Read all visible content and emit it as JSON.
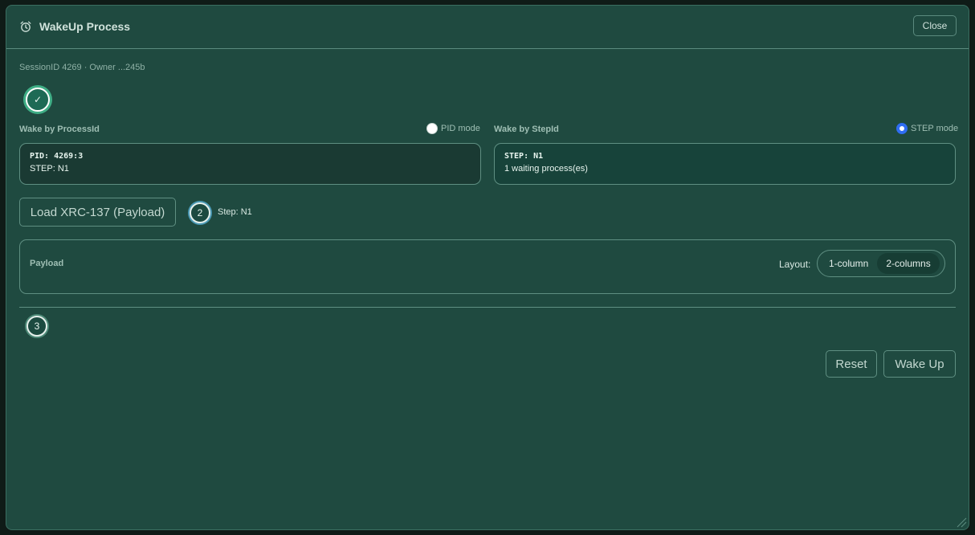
{
  "window": {
    "title": "WakeUp Process",
    "title_icon": "alarm-clock-icon",
    "close_label": "Close"
  },
  "session": {
    "text": "SessionID 4269 · Owner ...245b"
  },
  "steps": {
    "step1_mark": "✓",
    "step2_number": "2",
    "step2_label": "Step: N1",
    "step3_number": "3"
  },
  "pid_section": {
    "label": "Wake by ProcessId",
    "mode_label": "PID mode",
    "selected": false,
    "line1": "PID: 4269:3",
    "line2": "STEP: N1"
  },
  "step_section": {
    "label": "Wake by StepId",
    "mode_label": "STEP mode",
    "selected": true,
    "line1": "STEP: N1",
    "line2": "1 waiting process(es)"
  },
  "load_button": {
    "label": "Load XRC-137 (Payload)"
  },
  "payload": {
    "label": "Payload",
    "layout_label": "Layout:",
    "options": [
      "1-column",
      "2-columns"
    ],
    "selected": "2-columns"
  },
  "actions": {
    "reset_label": "Reset",
    "wake_label": "Wake Up"
  },
  "colors": {
    "panel_bg": "#1f4a40",
    "accent_green": "#3fae86",
    "radio_selected": "#2f6df2"
  }
}
